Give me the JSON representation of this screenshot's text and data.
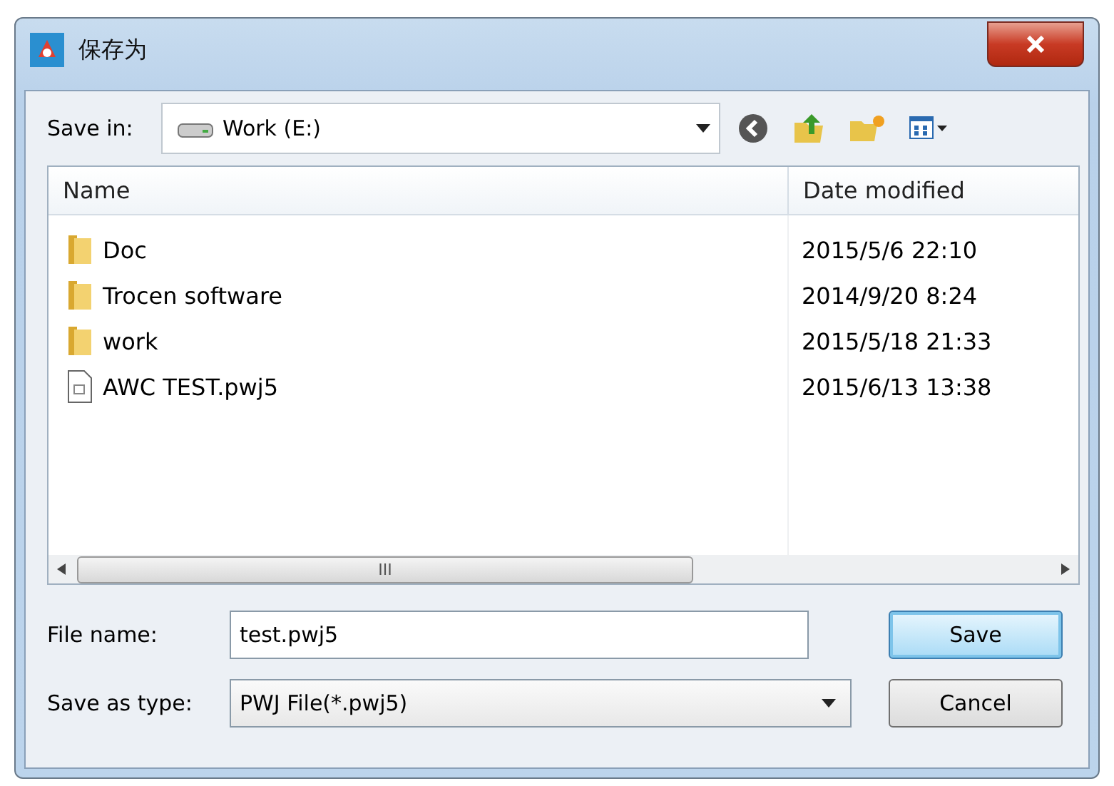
{
  "window": {
    "title": "保存为"
  },
  "save_in": {
    "label": "Save in:",
    "value": "Work (E:)"
  },
  "table": {
    "columns": [
      "Name",
      "Date modified"
    ],
    "rows": [
      {
        "kind": "folder",
        "name": "Doc",
        "date": "2015/5/6 22:10"
      },
      {
        "kind": "folder",
        "name": "Trocen software",
        "date": "2014/9/20 8:24"
      },
      {
        "kind": "folder",
        "name": "work",
        "date": "2015/5/18 21:33"
      },
      {
        "kind": "file",
        "name": "AWC TEST.pwj5",
        "date": "2015/6/13 13:38"
      }
    ]
  },
  "scrollbar_thumb": "III",
  "file_name": {
    "label": "File name:",
    "value": "test.pwj5"
  },
  "save_as_type": {
    "label": "Save as type:",
    "value": "PWJ File(*.pwj5)"
  },
  "buttons": [
    {
      "label": "Save",
      "kind": "default"
    },
    {
      "label": "Cancel",
      "kind": "normal"
    }
  ]
}
